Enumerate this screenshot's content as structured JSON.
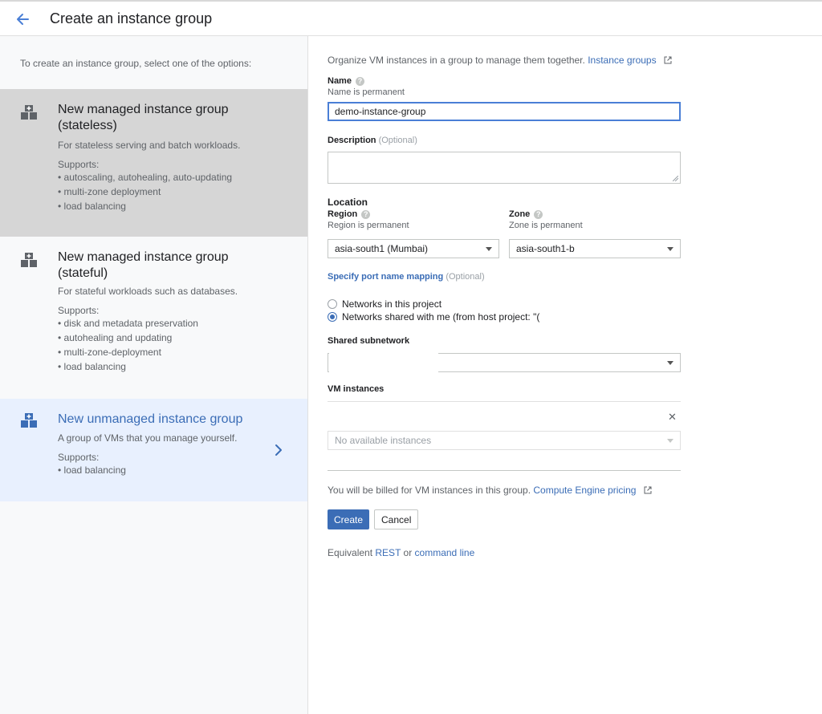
{
  "header": {
    "title": "Create an instance group"
  },
  "sidebar": {
    "intro": "To create an instance group, select one of the options:",
    "options": [
      {
        "title": "New managed instance group (stateless)",
        "description": "For stateless serving and batch workloads.",
        "supports_label": "Supports:",
        "supports": [
          "autoscaling, autohealing, auto-updating",
          "multi-zone deployment",
          "load balancing"
        ],
        "icon": "instance-group-icon",
        "state": "selected"
      },
      {
        "title": "New managed instance group (stateful)",
        "description": "For stateful workloads such as databases.",
        "supports_label": "Supports:",
        "supports": [
          "disk and metadata preservation",
          "autohealing and updating",
          "multi-zone-deployment",
          "load balancing"
        ],
        "icon": "instance-group-icon",
        "state": "normal"
      },
      {
        "title": "New unmanaged instance group",
        "description": "A group of VMs that you manage yourself.",
        "supports_label": "Supports:",
        "supports": [
          "load balancing"
        ],
        "icon": "instance-group-icon",
        "state": "active"
      }
    ]
  },
  "form": {
    "intro_text": "Organize VM instances in a group to manage them together.",
    "intro_link": "Instance groups",
    "name": {
      "label": "Name",
      "hint": "Name is permanent",
      "value": "demo-instance-group"
    },
    "description": {
      "label": "Description",
      "optional": "(Optional)",
      "value": ""
    },
    "location": {
      "label": "Location",
      "region_label": "Region",
      "region_hint": "Region is permanent",
      "region_value": "asia-south1 (Mumbai)",
      "zone_label": "Zone",
      "zone_hint": "Zone is permanent",
      "zone_value": "asia-south1-b"
    },
    "port_mapping": {
      "link": "Specify port name mapping",
      "optional": "(Optional)"
    },
    "network": {
      "options": [
        "Networks in this project",
        "Networks shared with me (from host project: \"("
      ],
      "selected_index": 1
    },
    "shared_subnetwork": {
      "label": "Shared subnetwork",
      "value": ""
    },
    "vm_instances": {
      "label": "VM instances",
      "placeholder": "No available instances"
    },
    "billing": {
      "text": "You will be billed for VM instances in this group.",
      "link": "Compute Engine pricing"
    },
    "buttons": {
      "create": "Create",
      "cancel": "Cancel"
    },
    "equivalent": {
      "prefix": "Equivalent",
      "rest": "REST",
      "or": "or",
      "command_line": "command line"
    }
  },
  "colors": {
    "accent": "#3b6db6",
    "selected_bg": "#d6d6d6",
    "active_bg": "#e8f0fe"
  }
}
